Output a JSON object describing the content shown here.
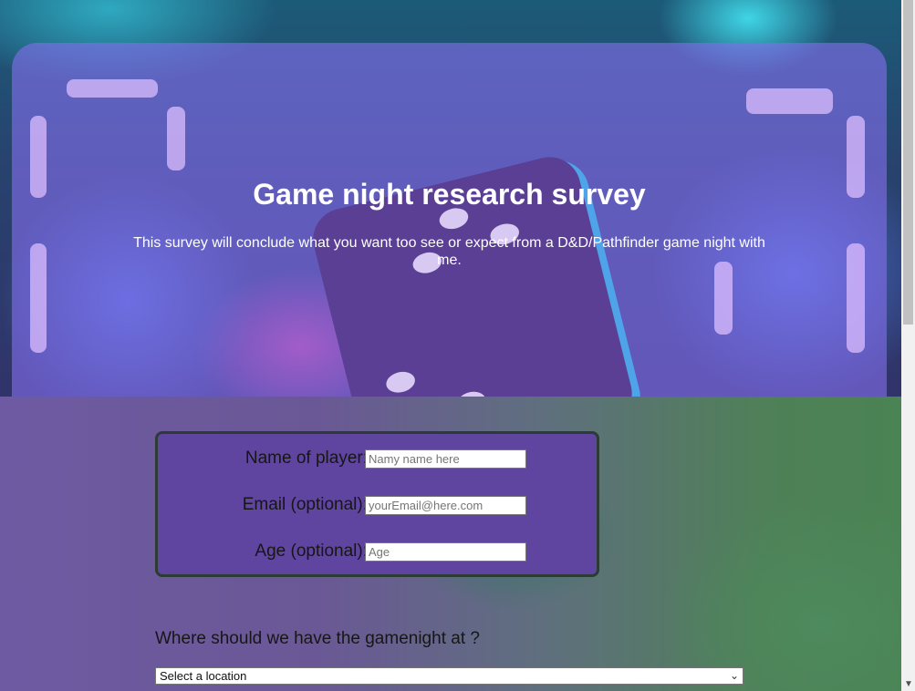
{
  "hero": {
    "title": "Game night research survey",
    "subtitle": "This survey will conclude what you want too see or expect from a D&D/Pathfinder game night with me."
  },
  "form": {
    "name": {
      "label": "Name of player:",
      "placeholder": "Namy name here"
    },
    "email": {
      "label": "Email (optional):",
      "placeholder": "yourEmail@here.com"
    },
    "age": {
      "label": "Age (optional):",
      "placeholder": "Age"
    }
  },
  "location": {
    "question": "Where should we have the gamenight at ?",
    "selected": "Select a location"
  },
  "colors": {
    "hero_overlay": "#826EEB",
    "form_card": "#5F45A0",
    "text": "#FFFFFF"
  }
}
